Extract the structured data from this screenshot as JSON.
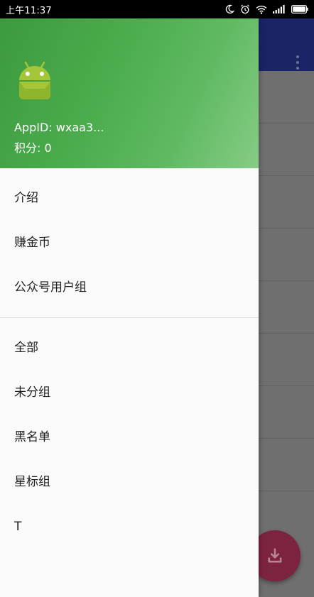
{
  "status_bar": {
    "time": "上午11:37",
    "icons": [
      "moon-icon",
      "alarm-icon",
      "wifi-icon",
      "signal-icon",
      "battery-icon"
    ]
  },
  "drawer": {
    "header": {
      "appid_label": "AppID: wxaa3...",
      "points_label": "积分: 0",
      "gradient_start": "#3d9a3e",
      "gradient_end": "#86cc85"
    },
    "primary_items": [
      {
        "label": "介绍"
      },
      {
        "label": "赚金币"
      },
      {
        "label": "公众号用户组"
      }
    ],
    "group_items": [
      {
        "label": "全部"
      },
      {
        "label": "未分组"
      },
      {
        "label": "黑名单"
      },
      {
        "label": "星标组"
      },
      {
        "label": "T"
      }
    ]
  },
  "background_app": {
    "toolbar_color": "#1a2466",
    "fab_color": "#c2185b",
    "fab_icon": "download-icon",
    "menu_icon": "more-vert-icon"
  }
}
